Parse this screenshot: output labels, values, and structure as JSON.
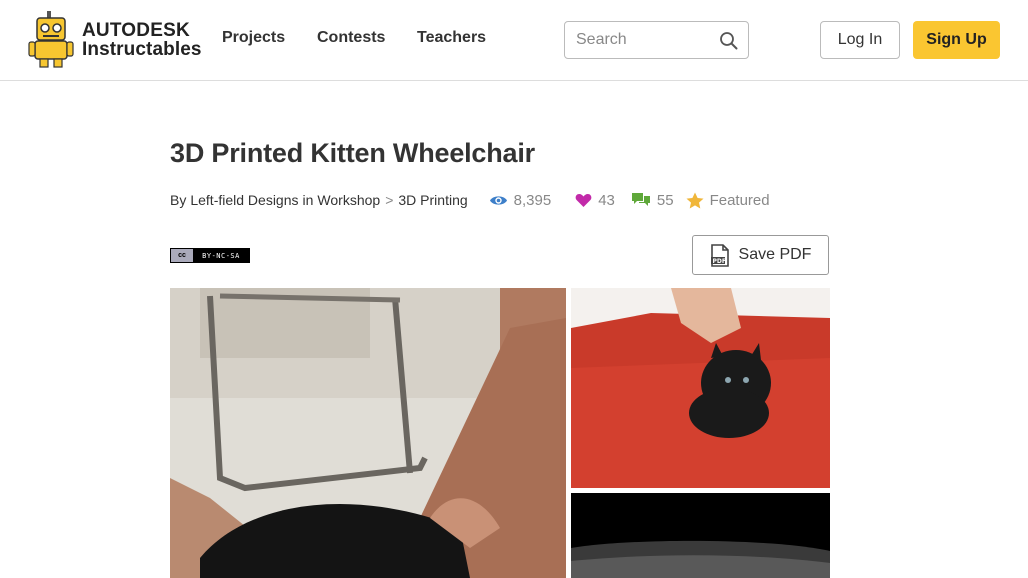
{
  "header": {
    "logo_line1": "AUTODESK",
    "logo_line2": "Instructables",
    "nav": [
      "Projects",
      "Contests",
      "Teachers"
    ],
    "search_placeholder": "Search",
    "login_label": "Log In",
    "signup_label": "Sign Up"
  },
  "article": {
    "title": "3D Printed Kitten Wheelchair",
    "by_prefix": "By",
    "author": "Left-field Designs",
    "in_word": "in",
    "category": "Workshop",
    "category_sep": ">",
    "subcategory": "3D Printing",
    "views": "8,395",
    "favorites": "43",
    "comments": "55",
    "featured_label": "Featured",
    "license_text": "BY-NC-SA",
    "license_cc": "cc",
    "save_pdf_label": "Save PDF"
  },
  "colors": {
    "accent_yellow": "#fac631",
    "views_icon": "#3d7fc9",
    "heart_icon": "#c22aa9",
    "comment_icon": "#5fa83a",
    "star_icon": "#f0b63a"
  },
  "icons": {
    "search": "search-icon",
    "views": "eye-icon",
    "favorites": "heart-icon",
    "comments": "comment-icon",
    "featured": "star-icon",
    "pdf": "pdf-file-icon"
  }
}
